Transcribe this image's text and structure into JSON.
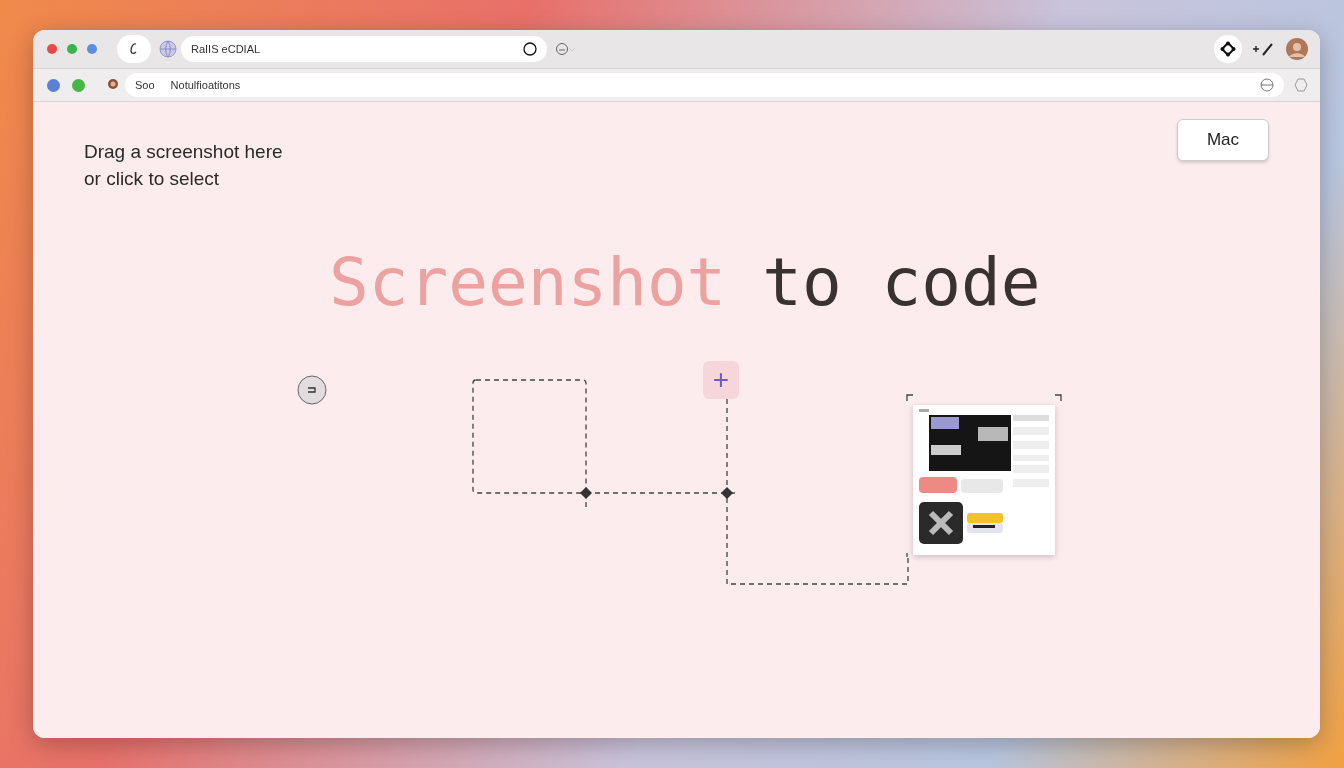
{
  "browser": {
    "tab_field": {
      "value": "RaIIS eCDIAL"
    },
    "address_field": {
      "prefix": "Soo",
      "value": "Notulfioatitons"
    }
  },
  "content": {
    "instruction": "Drag a screenshot here or click to select",
    "platform_button": {
      "label": "Mac"
    },
    "title_parts": [
      {
        "text": "Screenshot",
        "kind": "accent"
      },
      {
        "text": "to code",
        "kind": "plain"
      }
    ],
    "add_button": {
      "label": "+"
    }
  }
}
